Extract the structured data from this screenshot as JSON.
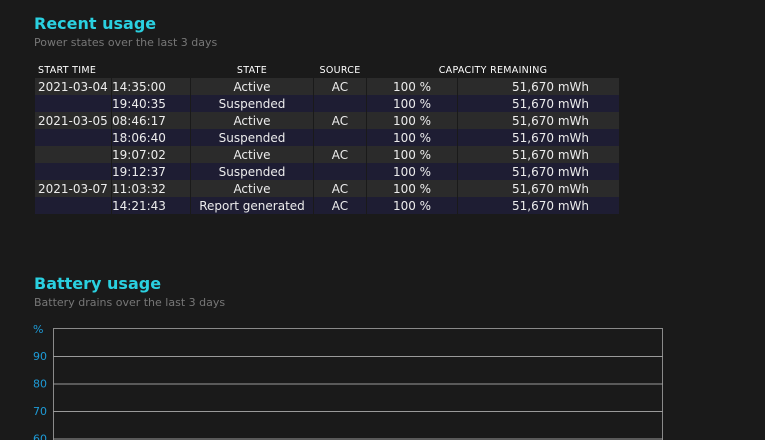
{
  "recent_usage": {
    "title": "Recent usage",
    "subtitle": "Power states over the last 3 days",
    "columns": {
      "start_time": "START TIME",
      "state": "STATE",
      "source": "SOURCE",
      "capacity_remaining": "CAPACITY REMAINING"
    },
    "rows": [
      {
        "date": "2021-03-04",
        "time": "14:35:00",
        "state": "Active",
        "source": "AC",
        "percent": "100 %",
        "capacity": "51,670 mWh"
      },
      {
        "date": "",
        "time": "19:40:35",
        "state": "Suspended",
        "source": "",
        "percent": "100 %",
        "capacity": "51,670 mWh"
      },
      {
        "date": "2021-03-05",
        "time": "08:46:17",
        "state": "Active",
        "source": "AC",
        "percent": "100 %",
        "capacity": "51,670 mWh"
      },
      {
        "date": "",
        "time": "18:06:40",
        "state": "Suspended",
        "source": "",
        "percent": "100 %",
        "capacity": "51,670 mWh"
      },
      {
        "date": "",
        "time": "19:07:02",
        "state": "Active",
        "source": "AC",
        "percent": "100 %",
        "capacity": "51,670 mWh"
      },
      {
        "date": "",
        "time": "19:12:37",
        "state": "Suspended",
        "source": "",
        "percent": "100 %",
        "capacity": "51,670 mWh"
      },
      {
        "date": "2021-03-07",
        "time": "11:03:32",
        "state": "Active",
        "source": "AC",
        "percent": "100 %",
        "capacity": "51,670 mWh"
      },
      {
        "date": "",
        "time": "14:21:43",
        "state": "Report generated",
        "source": "AC",
        "percent": "100 %",
        "capacity": "51,670 mWh"
      }
    ]
  },
  "battery_usage": {
    "title": "Battery usage",
    "subtitle": "Battery drains over the last 3 days",
    "y_axis_label": "%",
    "y_ticks": [
      "90",
      "80",
      "70",
      "60"
    ]
  },
  "colors": {
    "heading": "#2ad0e0",
    "axis_label": "#1e9bd7",
    "row_odd": "#2b2b2b",
    "row_even": "#1e1d33",
    "background": "#1a1a1a"
  }
}
